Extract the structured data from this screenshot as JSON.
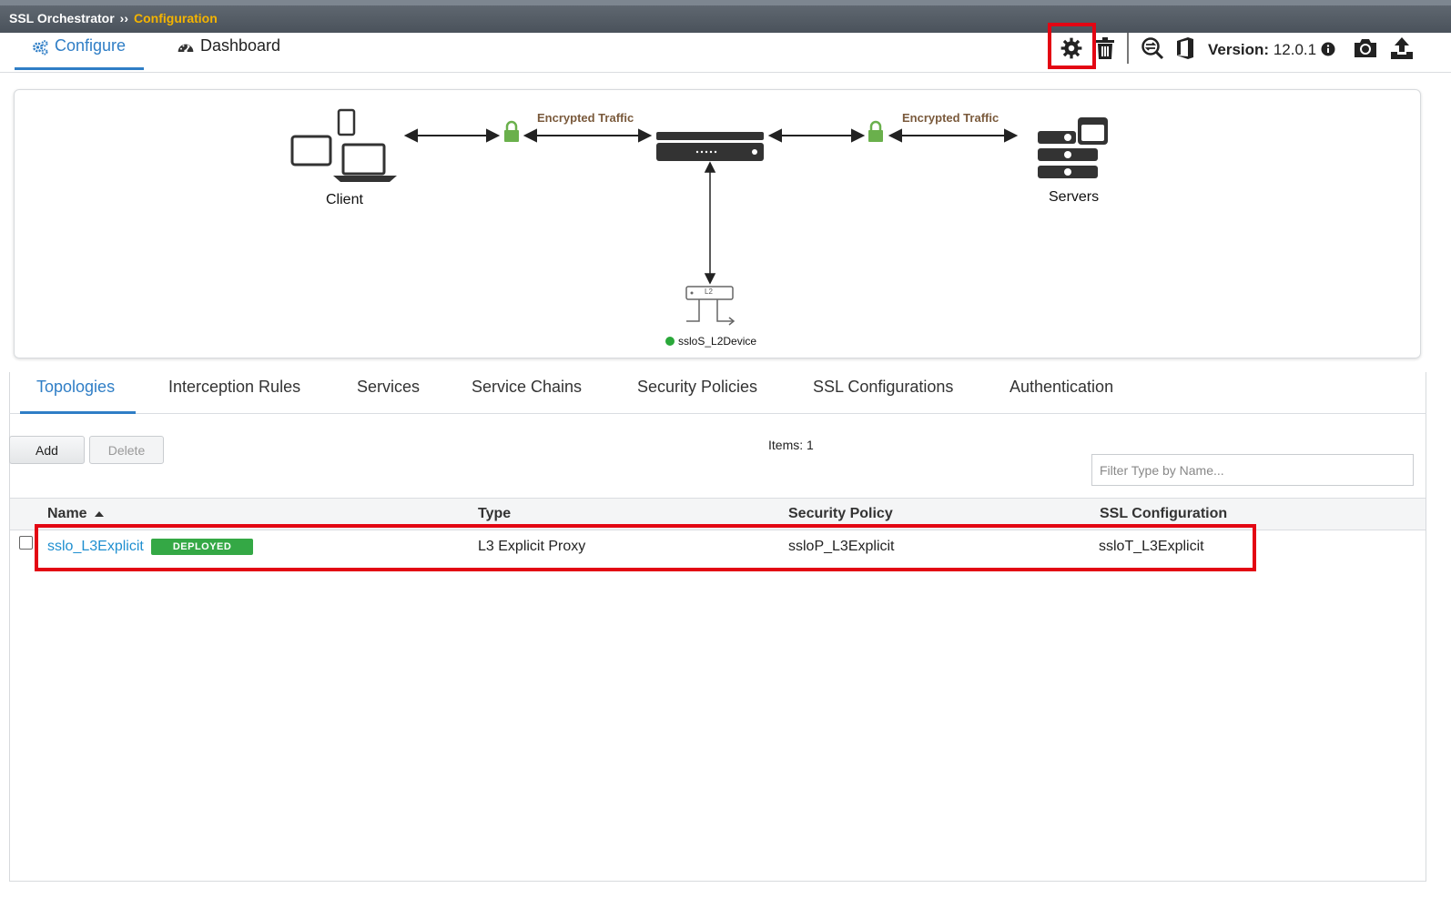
{
  "breadcrumb": {
    "root": "SSL Orchestrator",
    "separator": "››",
    "current": "Configuration"
  },
  "main_tabs": [
    {
      "label": "Configure",
      "icon": "gears-icon",
      "active": true
    },
    {
      "label": "Dashboard",
      "icon": "dashboard-gauge-icon",
      "active": false
    }
  ],
  "toolbar": {
    "icons": [
      "gear-icon",
      "trash-icon",
      "zoom-refresh-icon",
      "office-icon",
      "camera-icon",
      "upload-icon"
    ],
    "version_label": "Version:",
    "version_value": "12.0.1",
    "info_icon": "info-circle-icon"
  },
  "diagram": {
    "client_label": "Client",
    "servers_label": "Servers",
    "encrypted_left": "Encrypted Traffic",
    "encrypted_right": "Encrypted Traffic",
    "device_tag": "L2",
    "service_name": "ssloS_L2Device",
    "service_status_color": "#2aa83a"
  },
  "sub_tabs": [
    {
      "label": "Topologies",
      "active": true
    },
    {
      "label": "Interception Rules"
    },
    {
      "label": "Services"
    },
    {
      "label": "Service Chains"
    },
    {
      "label": "Security Policies"
    },
    {
      "label": "SSL Configurations"
    },
    {
      "label": "Authentication"
    }
  ],
  "actions": {
    "add_label": "Add",
    "delete_label": "Delete"
  },
  "items_label": "Items: 1",
  "filter": {
    "placeholder": "Filter Type by Name...",
    "value": ""
  },
  "table": {
    "columns": [
      "Name",
      "Type",
      "Security Policy",
      "SSL Configuration"
    ],
    "rows": [
      {
        "name": "sslo_L3Explicit",
        "status": "DEPLOYED",
        "type": "L3 Explicit Proxy",
        "security_policy": "ssloP_L3Explicit",
        "ssl_configuration": "ssloT_L3Explicit"
      }
    ]
  },
  "colors": {
    "accent": "#2f7ec6",
    "highlight": "#e30613",
    "deployed": "#34a845",
    "breadcrumb_current": "#f4b400"
  }
}
